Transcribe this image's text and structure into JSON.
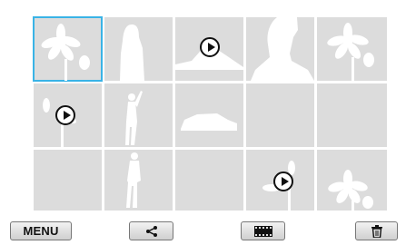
{
  "gallery": {
    "thumbnails": [
      {
        "subject": "flower",
        "type": "photo",
        "selected": true
      },
      {
        "subject": "woman-silhouette",
        "type": "photo",
        "selected": false
      },
      {
        "subject": "landscape",
        "type": "video",
        "selected": false
      },
      {
        "subject": "woman-closeup",
        "type": "photo",
        "selected": false
      },
      {
        "subject": "flower",
        "type": "photo",
        "selected": false
      },
      {
        "subject": "flower-partial",
        "type": "video",
        "selected": false
      },
      {
        "subject": "man-pointing",
        "type": "photo",
        "selected": false
      },
      {
        "subject": "car",
        "type": "photo",
        "selected": false
      },
      {
        "subject": "blank",
        "type": "photo",
        "selected": false
      },
      {
        "subject": "blank",
        "type": "photo",
        "selected": false
      },
      {
        "subject": "blank",
        "type": "photo",
        "selected": false
      },
      {
        "subject": "man-standing",
        "type": "photo",
        "selected": false
      },
      {
        "subject": "blank",
        "type": "photo",
        "selected": false
      },
      {
        "subject": "flower-partial",
        "type": "video",
        "selected": false
      },
      {
        "subject": "flower",
        "type": "photo",
        "selected": false
      }
    ],
    "accent_color": "#39b3e6"
  },
  "toolbar": {
    "menu_label": "MENU",
    "share_icon": "share-icon",
    "filmstrip_icon": "filmstrip-icon",
    "delete_icon": "trash-icon"
  }
}
